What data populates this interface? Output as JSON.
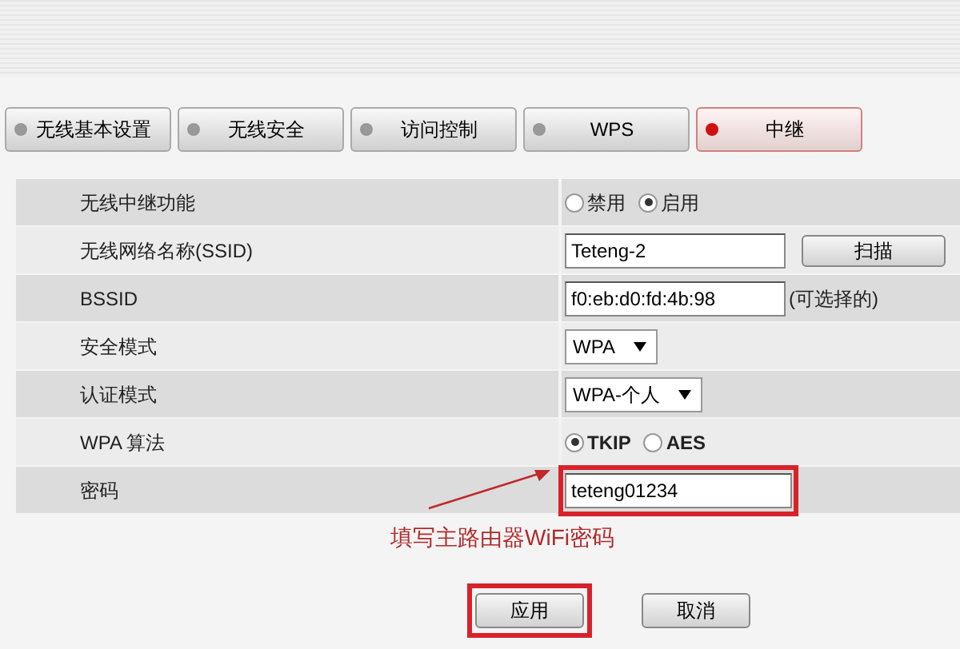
{
  "tabs": [
    {
      "label": "无线基本设置",
      "selected": false
    },
    {
      "label": "无线安全",
      "selected": false
    },
    {
      "label": "访问控制",
      "selected": false
    },
    {
      "label": "WPS",
      "selected": false
    },
    {
      "label": "中继",
      "selected": true
    }
  ],
  "rows": [
    {
      "kind": "radio",
      "label": "无线中继功能",
      "options": [
        {
          "label": "禁用",
          "selected": false,
          "bold": false
        },
        {
          "label": "启用",
          "selected": true,
          "bold": false
        }
      ]
    },
    {
      "kind": "input",
      "label": "无线网络名称(SSID)",
      "value": "Teteng-2",
      "button": "扫描",
      "highlighted": false
    },
    {
      "kind": "input",
      "label": "BSSID",
      "value": "f0:eb:d0:fd:4b:98",
      "note": "(可选择的)",
      "highlighted": false
    },
    {
      "kind": "select",
      "label": "安全模式",
      "value": "WPA"
    },
    {
      "kind": "select",
      "label": "认证模式",
      "value": "WPA-个人"
    },
    {
      "kind": "radio",
      "label": "WPA 算法",
      "options": [
        {
          "label": "TKIP",
          "selected": true,
          "bold": true
        },
        {
          "label": "AES",
          "selected": false,
          "bold": true
        }
      ]
    },
    {
      "kind": "input",
      "label": "密码",
      "value": "teteng01234",
      "highlighted": true
    }
  ],
  "annotation": "填写主路由器WiFi密码",
  "buttons": [
    {
      "label": "应用",
      "highlighted": true
    },
    {
      "label": "取消",
      "highlighted": false
    }
  ]
}
